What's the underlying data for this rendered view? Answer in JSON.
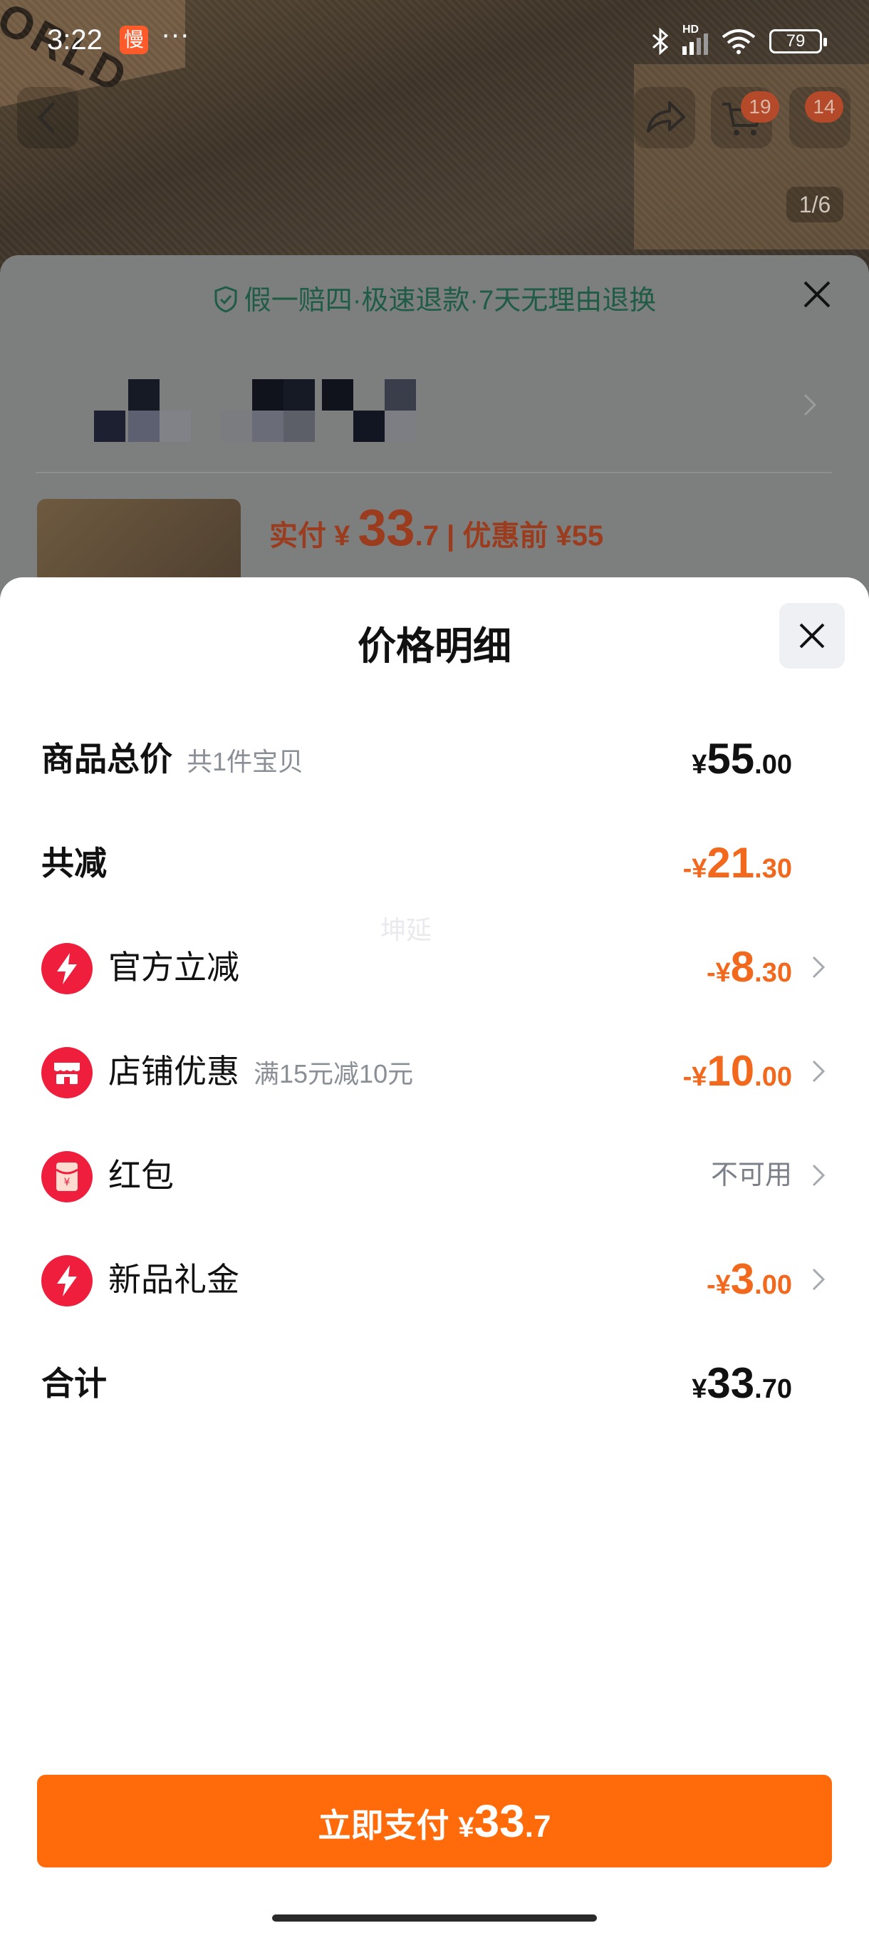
{
  "status_bar": {
    "time": "3:22",
    "app_badge": "慢",
    "dots": "···",
    "battery": "79",
    "network": "HD"
  },
  "header": {
    "cart_count": "19",
    "more_count": "14",
    "pager": "1/6"
  },
  "background": {
    "guarantee": "假一赔四·极速退款·7天无理由退换",
    "price_label": "实付 ¥ ",
    "price_int": "33",
    "price_dec": ".7",
    "price_before": " | 优惠前 ¥55",
    "box_word": "ORLD"
  },
  "modal": {
    "title": "价格明细",
    "watermark": "坤延",
    "rows": [
      {
        "label": "商品总价",
        "sub": "共1件宝贝",
        "sym": "¥",
        "int": "55",
        "dec": ".00"
      },
      {
        "label": "共减",
        "sym": "-¥",
        "int": "21",
        "dec": ".30"
      },
      {
        "label": "官方立减",
        "icon": "lightning-icon",
        "sym": "-¥",
        "int": "8",
        "dec": ".30"
      },
      {
        "label": "店铺优惠",
        "sub": "满15元减10元",
        "icon": "store-icon",
        "sym": "-¥",
        "int": "10",
        "dec": ".00"
      },
      {
        "label": "红包",
        "icon": "red-envelope-icon",
        "status": "不可用"
      },
      {
        "label": "新品礼金",
        "icon": "lightning-icon",
        "sym": "-¥",
        "int": "3",
        "dec": ".00"
      },
      {
        "label": "合计",
        "sym": "¥",
        "int": "33",
        "dec": ".70"
      }
    ],
    "pay_button": {
      "text": "立即支付 ",
      "sym": "¥",
      "int": "33",
      "dec": ".7"
    }
  },
  "colors": {
    "accent": "#ff6a0a",
    "discount": "#f2681d",
    "icon_red": "#ee1e3c",
    "guarantee_green": "#1f5c45"
  }
}
